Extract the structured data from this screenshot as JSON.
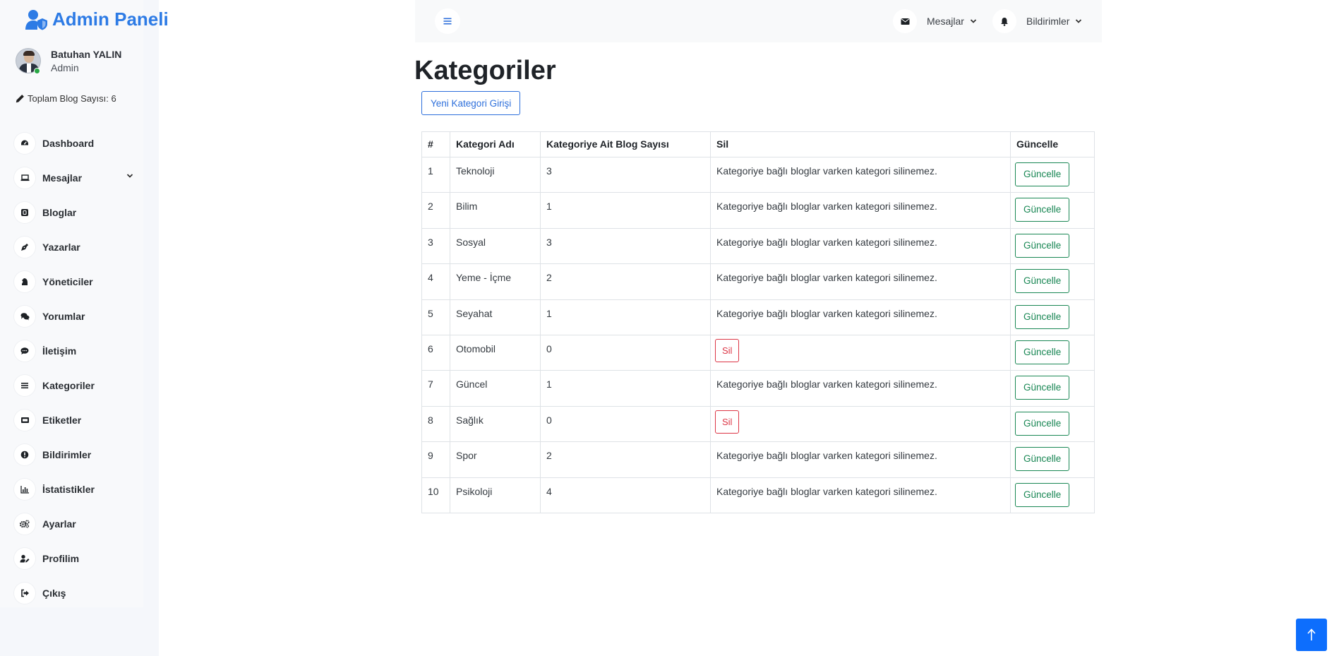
{
  "brand": {
    "title": "Admin Paneli"
  },
  "user": {
    "name": "Batuhan YALIN",
    "role": "Admin"
  },
  "blog_count_text": "Toplam Blog Sayısı: 6",
  "sidebar": {
    "items": [
      {
        "label": "Dashboard",
        "icon": "dashboard-icon"
      },
      {
        "label": "Mesajlar",
        "icon": "laptop-icon"
      },
      {
        "label": "Bloglar",
        "icon": "blog-icon"
      },
      {
        "label": "Yazarlar",
        "icon": "pen-nib-icon"
      },
      {
        "label": "Yöneticiler",
        "icon": "chess-knight-icon"
      },
      {
        "label": "Yorumlar",
        "icon": "comments-icon"
      },
      {
        "label": "İletişim",
        "icon": "comment-dots-icon"
      },
      {
        "label": "Kategoriler",
        "icon": "list-icon"
      },
      {
        "label": "Etiketler",
        "icon": "tag-icon"
      },
      {
        "label": "Bildirimler",
        "icon": "info-icon"
      },
      {
        "label": "İstatistikler",
        "icon": "chart-icon"
      },
      {
        "label": "Ayarlar",
        "icon": "gears-icon"
      },
      {
        "label": "Profilim",
        "icon": "user-pen-icon"
      },
      {
        "label": "Çıkış",
        "icon": "sign-out-icon"
      }
    ]
  },
  "topbar": {
    "messages_label": "Mesajlar",
    "notifications_label": "Bildirimler"
  },
  "page": {
    "title": "Kategoriler",
    "new_button": "Yeni Kategori Girişi"
  },
  "table": {
    "headers": {
      "num": "#",
      "name": "Kategori Adı",
      "count": "Kategoriye Ait Blog Sayısı",
      "delete": "Sil",
      "update": "Güncelle"
    },
    "delete_label": "Sil",
    "update_label": "Güncelle",
    "locked_text": "Kategoriye bağlı bloglar varken kategori silinemez.",
    "rows": [
      {
        "num": "1",
        "name": "Teknoloji",
        "count": "3"
      },
      {
        "num": "2",
        "name": "Bilim",
        "count": "1"
      },
      {
        "num": "3",
        "name": "Sosyal",
        "count": "3"
      },
      {
        "num": "4",
        "name": "Yeme - İçme",
        "count": "2"
      },
      {
        "num": "5",
        "name": "Seyahat",
        "count": "1"
      },
      {
        "num": "6",
        "name": "Otomobil",
        "count": "0"
      },
      {
        "num": "7",
        "name": "Güncel",
        "count": "1"
      },
      {
        "num": "8",
        "name": "Sağlık",
        "count": "0"
      },
      {
        "num": "9",
        "name": "Spor",
        "count": "2"
      },
      {
        "num": "10",
        "name": "Psikoloji",
        "count": "4"
      }
    ]
  },
  "colors": {
    "brand": "#2d7be5",
    "primary": "#0d6efd",
    "danger": "#dc3545",
    "success": "#198754"
  }
}
